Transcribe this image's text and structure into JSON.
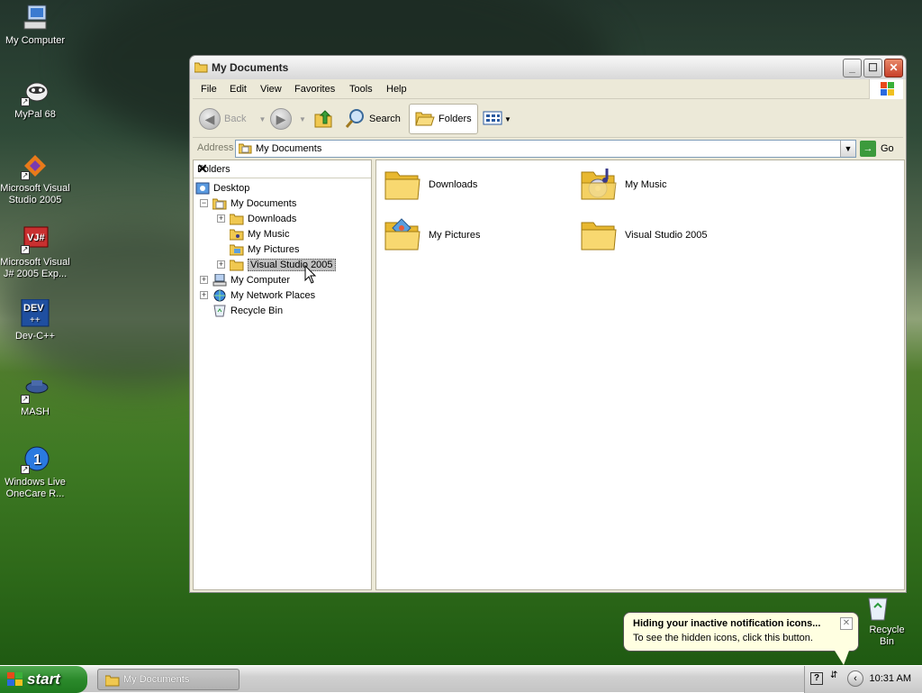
{
  "desktop": {
    "icons": [
      {
        "label": "My Computer",
        "icon": "computer-icon"
      },
      {
        "label": "MyPal 68",
        "icon": "mypal-icon"
      },
      {
        "label": "Microsoft Visual Studio 2005",
        "icon": "visual-studio-icon"
      },
      {
        "label": "Microsoft Visual J# 2005 Exp...",
        "icon": "vj-sharp-icon"
      },
      {
        "label": "Dev-C++",
        "icon": "dev-cpp-icon"
      },
      {
        "label": "MASH",
        "icon": "mash-icon"
      },
      {
        "label": "Windows Live OneCare R...",
        "icon": "onecare-icon"
      },
      {
        "label": "Recycle Bin",
        "icon": "recycle-bin-icon"
      }
    ]
  },
  "window": {
    "title": "My Documents",
    "menu": [
      "File",
      "Edit",
      "View",
      "Favorites",
      "Tools",
      "Help"
    ],
    "toolbar": {
      "back": "Back",
      "search": "Search",
      "folders": "Folders"
    },
    "address": {
      "label": "Address",
      "value": "My Documents",
      "go": "Go"
    },
    "folders_pane": {
      "title": "Folders",
      "tree": [
        {
          "label": "Desktop"
        },
        {
          "label": "My Documents"
        },
        {
          "label": "Downloads"
        },
        {
          "label": "My Music"
        },
        {
          "label": "My Pictures"
        },
        {
          "label": "Visual Studio 2005",
          "selected": true
        },
        {
          "label": "My Computer"
        },
        {
          "label": "My Network Places"
        },
        {
          "label": "Recycle Bin"
        }
      ]
    },
    "items": [
      {
        "label": "Downloads"
      },
      {
        "label": "My Music"
      },
      {
        "label": "My Pictures"
      },
      {
        "label": "Visual Studio 2005"
      }
    ]
  },
  "taskbar": {
    "start": "start",
    "task": "My Documents",
    "clock": "10:31 AM"
  },
  "balloon": {
    "title": "Hiding your inactive notification icons...",
    "text": "To see the hidden icons, click this button."
  }
}
